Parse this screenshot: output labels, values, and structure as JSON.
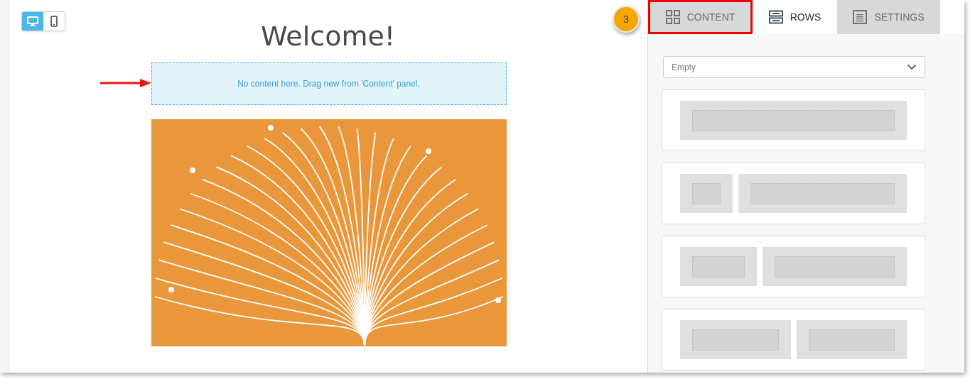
{
  "device_toggle": [
    {
      "kind": "desktop",
      "selected": true
    },
    {
      "kind": "mobile",
      "selected": false
    }
  ],
  "canvas": {
    "heading": "Welcome!",
    "empty_block": "No content here. Drag new from 'Content' panel."
  },
  "step_badge": "3",
  "tabs": [
    {
      "label": "CONTENT",
      "kind": "content",
      "selected": false,
      "highlighted": true
    },
    {
      "label": "ROWS",
      "kind": "rows",
      "selected": true,
      "highlighted": false
    },
    {
      "label": "SETTINGS",
      "kind": "settings",
      "selected": false,
      "highlighted": false
    }
  ],
  "row_filter": {
    "value": "Empty"
  },
  "row_layouts": [
    {
      "kind": "full"
    },
    {
      "kind": "quarter-three-quarters"
    },
    {
      "kind": "third-two-thirds"
    },
    {
      "kind": "halves"
    }
  ]
}
